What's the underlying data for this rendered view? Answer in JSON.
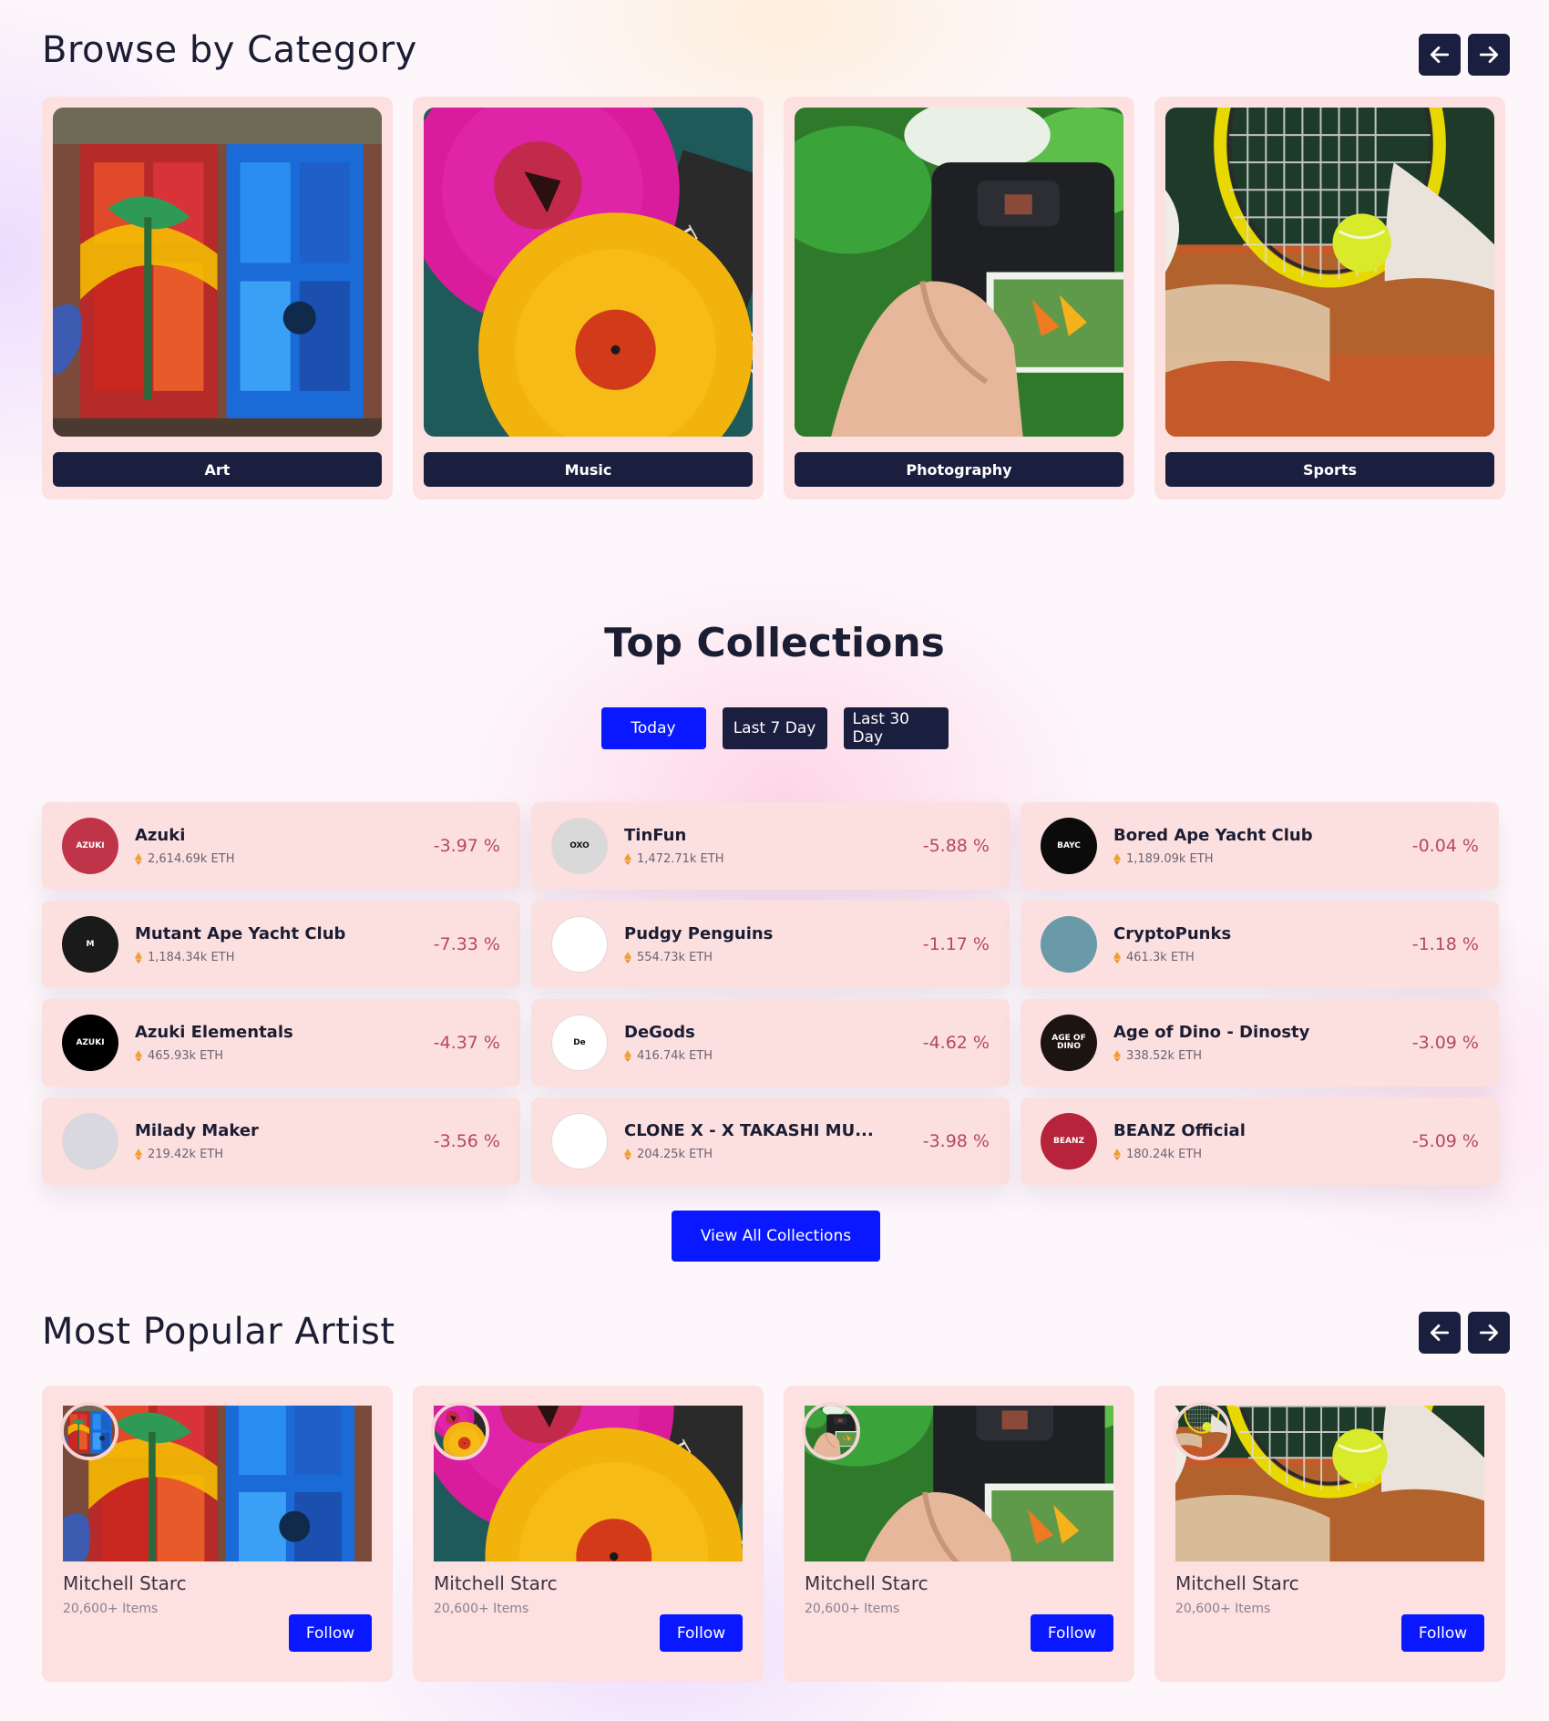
{
  "categories_section": {
    "title": "Browse by Category",
    "prev_icon": "arrow-left-icon",
    "next_icon": "arrow-right-icon",
    "items": [
      {
        "label": "Art",
        "image": "graffiti-painted-doors"
      },
      {
        "label": "Music",
        "image": "vinyl-records"
      },
      {
        "label": "Photography",
        "image": "camera-in-hand"
      },
      {
        "label": "Sports",
        "image": "tennis-racket-and-ball"
      }
    ]
  },
  "collections_section": {
    "title": "Top Collections",
    "filters": [
      {
        "label": "Today",
        "active": true
      },
      {
        "label": "Last 7 Day",
        "active": false
      },
      {
        "label": "Last 30 Day",
        "active": false
      }
    ],
    "currency_icon": "ethereum-icon",
    "items": [
      {
        "name": "Azuki",
        "volume": "2,614.69k ETH",
        "change": "-3.97 %",
        "avatar_text": "AZUKI",
        "avatar_color": "#c0344a"
      },
      {
        "name": "TinFun",
        "volume": "1,472.71k ETH",
        "change": "-5.88 %",
        "avatar_text": "OXO",
        "avatar_color": "#d9d9d9"
      },
      {
        "name": "Bored Ape Yacht Club",
        "volume": "1,189.09k ETH",
        "change": "-0.04 %",
        "avatar_text": "BAYC",
        "avatar_color": "#0b0b0b"
      },
      {
        "name": "Mutant Ape Yacht Club",
        "volume": "1,184.34k ETH",
        "change": "-7.33 %",
        "avatar_text": "M",
        "avatar_color": "#1a1a1a"
      },
      {
        "name": "Pudgy Penguins",
        "volume": "554.73k ETH",
        "change": "-1.17 %",
        "avatar_text": "",
        "avatar_color": "#ffffff"
      },
      {
        "name": "CryptoPunks",
        "volume": "461.3k ETH",
        "change": "-1.18 %",
        "avatar_text": "",
        "avatar_color": "#6a9aa8"
      },
      {
        "name": "Azuki Elementals",
        "volume": "465.93k ETH",
        "change": "-4.37 %",
        "avatar_text": "AZUKI",
        "avatar_color": "#000000"
      },
      {
        "name": "DeGods",
        "volume": "416.74k ETH",
        "change": "-4.62 %",
        "avatar_text": "De",
        "avatar_color": "#ffffff"
      },
      {
        "name": "Age of Dino - Dinosty",
        "volume": "338.52k ETH",
        "change": "-3.09 %",
        "avatar_text": "AGE OF DINO",
        "avatar_color": "#1c1410"
      },
      {
        "name": "Milady Maker",
        "volume": "219.42k ETH",
        "change": "-3.56 %",
        "avatar_text": "",
        "avatar_color": "#d8d8de"
      },
      {
        "name": "CLONE X - X TAKASHI MU...",
        "volume": "204.25k ETH",
        "change": "-3.98 %",
        "avatar_text": "",
        "avatar_color": "#ffffff"
      },
      {
        "name": "BEANZ Official",
        "volume": "180.24k ETH",
        "change": "-5.09 %",
        "avatar_text": "BEANZ",
        "avatar_color": "#b6233a"
      }
    ],
    "view_all_label": "View All Collections"
  },
  "artists_section": {
    "title": "Most Popular Artist",
    "prev_icon": "arrow-left-icon",
    "next_icon": "arrow-right-icon",
    "follow_label": "Follow",
    "items": [
      {
        "name": "Mitchell Starc",
        "items": "20,600+ Items",
        "image": "graffiti-painted-doors"
      },
      {
        "name": "Mitchell Starc",
        "items": "20,600+ Items",
        "image": "vinyl-records"
      },
      {
        "name": "Mitchell Starc",
        "items": "20,600+ Items",
        "image": "camera-in-hand"
      },
      {
        "name": "Mitchell Starc",
        "items": "20,600+ Items",
        "image": "tennis-racket-and-ball"
      }
    ]
  },
  "colors": {
    "navy": "#1a1f40",
    "blue": "#0a18ff",
    "card": "#fde0e0",
    "negative": "#b5495b",
    "eth": "#f0a030"
  }
}
